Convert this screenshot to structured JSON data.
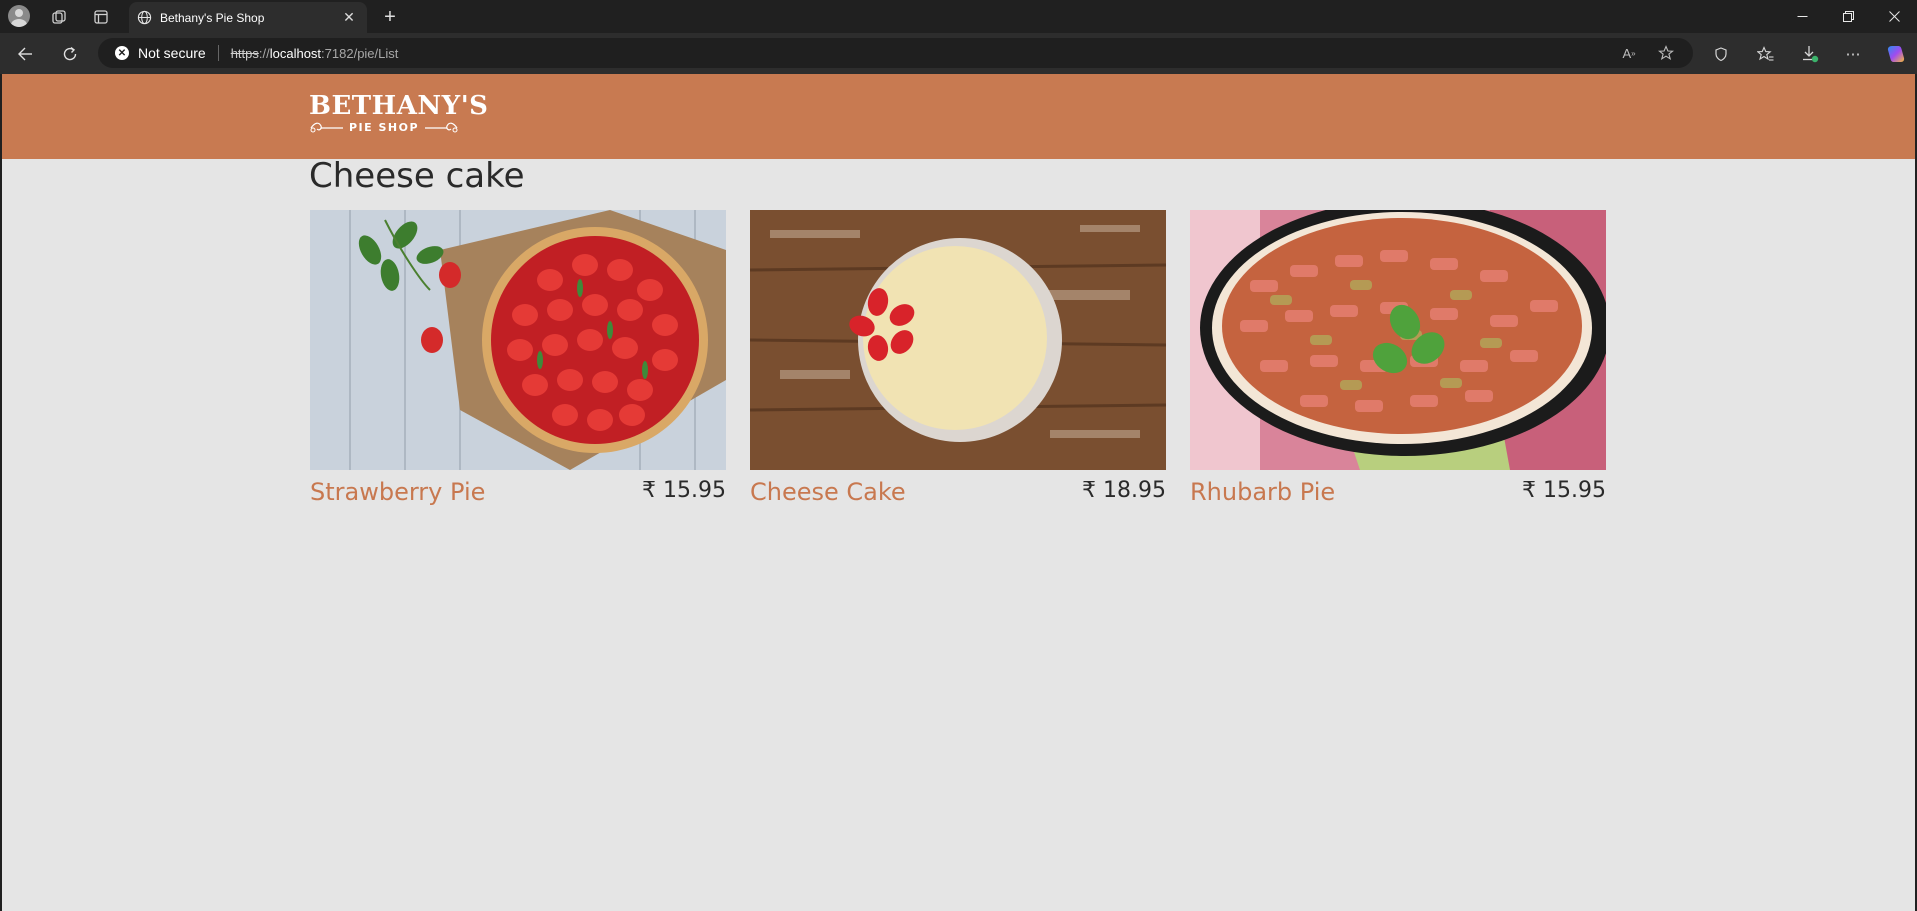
{
  "browser": {
    "tab_title": "Bethany's Pie Shop",
    "tab_icon": "globe-icon",
    "security_label": "Not secure",
    "url_protocol": "https",
    "url_separator": "://",
    "url_host": "localhost",
    "url_rest": ":7182/pie/List"
  },
  "site": {
    "logo_main": "BETHANY'S",
    "logo_sub": "PIE SHOP",
    "header_color": "#c87a51"
  },
  "page": {
    "heading": "Cheese cake"
  },
  "pies": [
    {
      "name": "Strawberry Pie",
      "price": "₹ 15.95"
    },
    {
      "name": "Cheese Cake",
      "price": "₹ 18.95"
    },
    {
      "name": "Rhubarb Pie",
      "price": "₹ 15.95"
    }
  ]
}
